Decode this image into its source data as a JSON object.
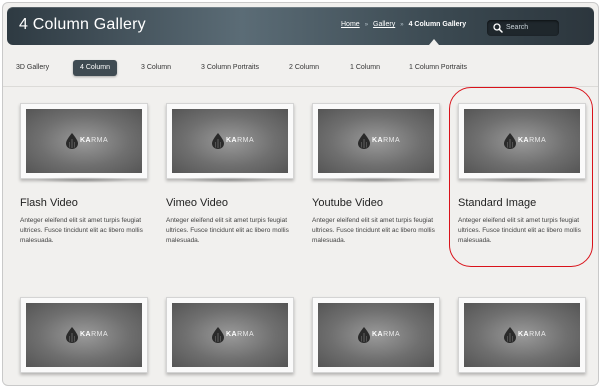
{
  "header": {
    "title": "4 Column Gallery",
    "breadcrumb": {
      "home": "Home",
      "sep": "»",
      "gallery": "Gallery",
      "current": "4 Column Gallery"
    },
    "search": {
      "placeholder": "Search"
    }
  },
  "filters": [
    {
      "label": "3D Gallery"
    },
    {
      "label": "4 Column",
      "active": true
    },
    {
      "label": "3 Column"
    },
    {
      "label": "3 Column Portraits"
    },
    {
      "label": "2 Column"
    },
    {
      "label": "1 Column"
    },
    {
      "label": "1 Column Portraits"
    }
  ],
  "logo": {
    "strong": "KA",
    "rest": "RMA"
  },
  "cards": [
    {
      "title": "Flash Video",
      "description": "Anteger eleifend elit sit amet turpis feugiat ultrices. Fusce tincidunt elit ac libero mollis malesuada."
    },
    {
      "title": "Vimeo Video",
      "description": "Anteger eleifend elit sit amet turpis feugiat ultrices. Fusce tincidunt elit ac libero mollis malesuada."
    },
    {
      "title": "Youtube Video",
      "description": "Anteger eleifend elit sit amet turpis feugiat ultrices. Fusce tincidunt elit ac libero mollis malesuada."
    },
    {
      "title": "Standard Image",
      "description": "Anteger eleifend elit sit amet turpis feugiat ultrices. Fusce tincidunt elit ac libero mollis malesuada."
    },
    {
      "title": "",
      "description": ""
    },
    {
      "title": "",
      "description": ""
    },
    {
      "title": "",
      "description": ""
    },
    {
      "title": "",
      "description": ""
    }
  ],
  "colors": {
    "header_dark": "#2e3a42",
    "active_filter": "#3f4b52",
    "highlight": "#d9121a",
    "page_bg": "#f1f0ee"
  }
}
